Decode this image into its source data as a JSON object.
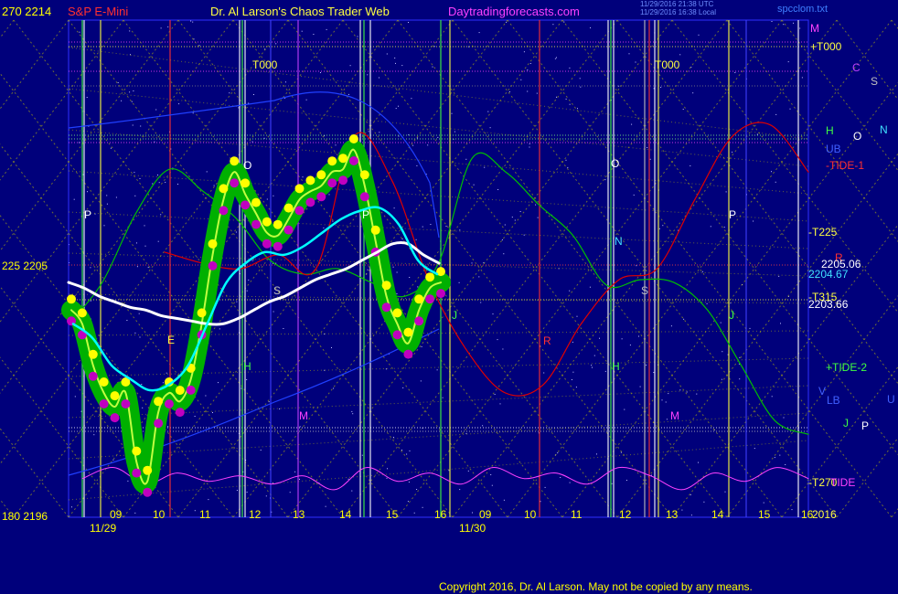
{
  "header": {
    "left_price": "270  2214",
    "instrument": "S&P E-Mini",
    "title": "Dr. Al Larson's Chaos Trader Web",
    "site": "Daytradingforecasts.com",
    "timestamp_1": "11/29/2016 21:38 UTC",
    "timestamp_2": "11/29/2016 16:38 Local",
    "file": "spcclom.txt"
  },
  "y_axis": {
    "mid": "225  2205",
    "bottom": "180  2196"
  },
  "right_labels": {
    "m": "M",
    "t000": "+T000",
    "c": "C",
    "s": "S",
    "h": "H",
    "o": "O",
    "n": "N",
    "ub": "UB",
    "tide1": "-TIDE-1",
    "t225": "-T225",
    "r": "R",
    "price1": "2205.06",
    "price2": "2204.67",
    "t315": "-T315",
    "price3": "2203.66",
    "tide2": "+TIDE-2",
    "v": "V",
    "lb": "LB",
    "u": "U",
    "j": "J",
    "p": "P",
    "t270": "-T270",
    "tide": "TIDE",
    "year": "2016"
  },
  "chart_labels": {
    "t000_a": "T000",
    "t000_b": "T000",
    "o_a": "O",
    "o_b": "O",
    "p_a": "P",
    "p_b": "P",
    "p_c": "P",
    "n_b": "N",
    "s_a": "S",
    "s_b": "S",
    "r_a": "R",
    "h_a": "H",
    "h_b": "H",
    "m_a": "M",
    "m_b": "M",
    "j_a": "J",
    "j_b": "J",
    "e_a": "E"
  },
  "x_axis": {
    "date1": "11/29",
    "date2": "11/30"
  },
  "copyright": "Copyright 2016, Dr. Al Larson. May not be copied by any means.",
  "colors": {
    "background": "#00007b",
    "price_band": "#00b000",
    "price_high": "#ffff00",
    "price_low": "#c000c0",
    "white_avg": "#ffffff",
    "cyan_avg": "#00ffff",
    "tide_green": "#00c000",
    "red_curve": "#e00000",
    "magenta_osc": "#ff40ff",
    "gridline_yellow": "#c8c800"
  },
  "chart_data": {
    "type": "line",
    "title": "S&P E-Mini",
    "y_left_scale": [
      180,
      270
    ],
    "y_price_scale": [
      2196,
      2214
    ],
    "x_ticks": [
      "09",
      "10",
      "11",
      "12",
      "13",
      "14",
      "15",
      "16",
      "09",
      "10",
      "11",
      "12",
      "13",
      "14",
      "15",
      "16"
    ],
    "dates": [
      "11/29",
      "11/30"
    ],
    "series": [
      {
        "name": "price",
        "values": [
          2203.5,
          2203.0,
          2201.5,
          2200.5,
          2200.0,
          2200.5,
          2198.0,
          2197.3,
          2199.8,
          2200.5,
          2200.2,
          2201.0,
          2203.0,
          2205.5,
          2207.5,
          2208.5,
          2207.7,
          2207.0,
          2206.3,
          2206.2,
          2206.8,
          2207.5,
          2207.8,
          2208.0,
          2208.5,
          2208.6,
          2209.3,
          2208.0,
          2206.0,
          2204.0,
          2203.0,
          2202.3,
          2203.5,
          2204.3,
          2204.5
        ]
      },
      {
        "name": "white_average",
        "values": [
          2204.5,
          2204.3,
          2204.0,
          2203.8,
          2203.6,
          2203.5,
          2203.3,
          2203.2,
          2203.1,
          2203.0,
          2203.0,
          2203.2,
          2203.5,
          2203.8,
          2204.0,
          2204.3,
          2204.6,
          2204.8,
          2205.0,
          2205.3,
          2205.6,
          2205.9,
          2205.9,
          2205.5,
          2205.2
        ]
      },
      {
        "name": "cyan_average",
        "values": [
          2203.0,
          2202.5,
          2201.5,
          2201.0,
          2200.6,
          2200.8,
          2201.5,
          2203.0,
          2204.5,
          2205.2,
          2205.6,
          2205.5,
          2205.8,
          2206.3,
          2206.8,
          2207.1,
          2207.2,
          2206.6,
          2205.3,
          2204.8
        ]
      },
      {
        "name": "tide_1",
        "values": [
          2203.0,
          2204.5,
          2207.0,
          2208.6,
          2207.8,
          2206.8,
          2205.3,
          2204.8,
          2205.0,
          2204.5,
          2204.0,
          2205.2,
          2209.0,
          2208.5,
          2207.3,
          2206.2,
          2204.4,
          2204.6,
          2204.5,
          2203.5,
          2201.5,
          2199.5,
          2199.0
        ]
      },
      {
        "name": "red_curve",
        "values": [
          2205.6,
          2205.2,
          2205.0,
          2205.5,
          2205.0,
          2209.8,
          2208.2,
          2204.5,
          2202.0,
          2200.5,
          2200.8,
          2203.0,
          2204.6,
          2205.0,
          2207.5,
          2209.8,
          2210.2,
          2208.5
        ]
      },
      {
        "name": "tide_oscillator",
        "values": [
          2197.4,
          2197.8,
          2197.2,
          2197.6,
          2197.3,
          2197.5,
          2197.2,
          2197.5,
          2197.0,
          2197.8,
          2197.3,
          2197.6,
          2197.2,
          2197.8,
          2197.4,
          2197.6,
          2197.2,
          2197.8,
          2197.5,
          2197.0,
          2197.6,
          2197.3,
          2197.8,
          2197.4
        ]
      }
    ]
  }
}
